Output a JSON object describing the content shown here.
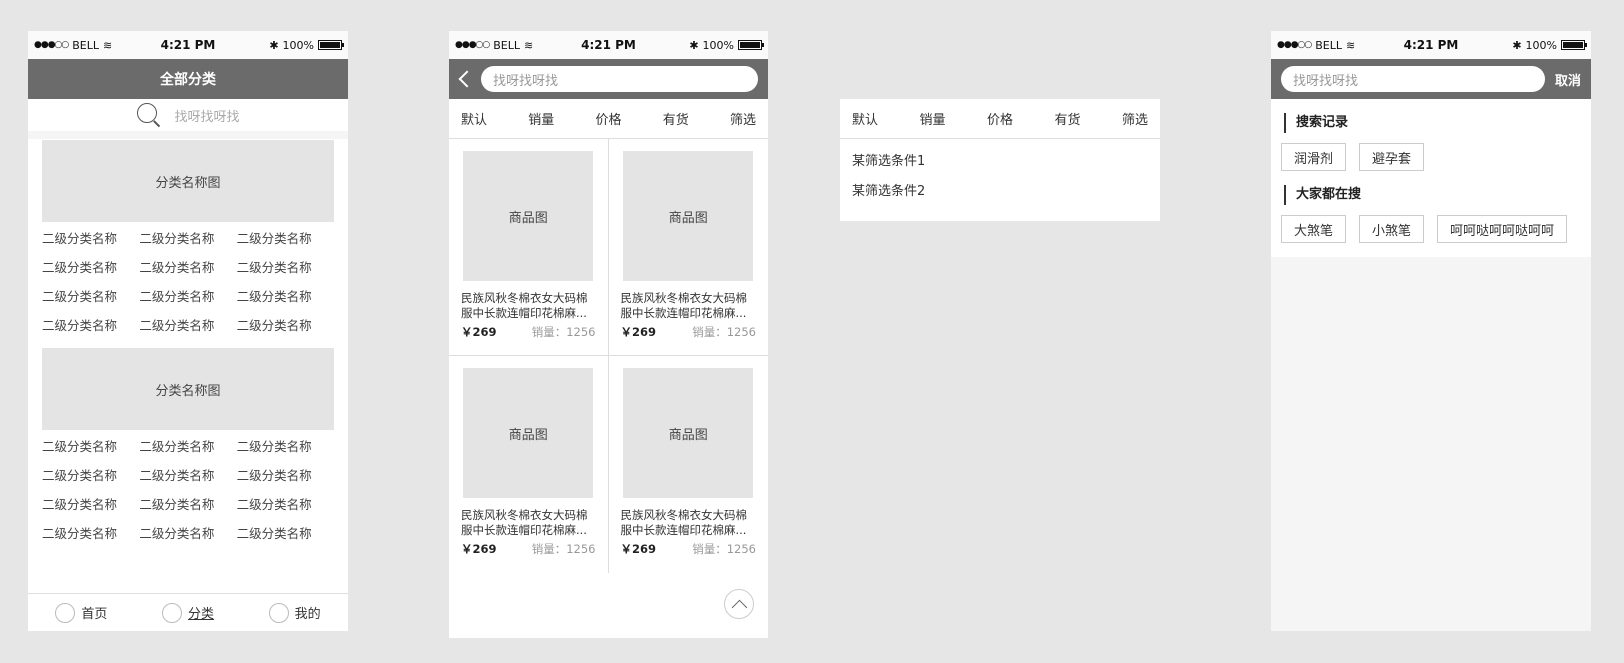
{
  "status": {
    "carrier": "BELL",
    "time": "4:21 PM",
    "battery": "100%"
  },
  "categories_screen": {
    "title": "全部分类",
    "search_placeholder": "找呀找呀找",
    "groups": [
      {
        "image_label": "分类名称图",
        "subcategories": [
          "二级分类名称",
          "二级分类名称",
          "二级分类名称",
          "二级分类名称",
          "二级分类名称",
          "二级分类名称",
          "二级分类名称",
          "二级分类名称",
          "二级分类名称",
          "二级分类名称",
          "二级分类名称",
          "二级分类名称"
        ]
      },
      {
        "image_label": "分类名称图",
        "subcategories": [
          "二级分类名称",
          "二级分类名称",
          "二级分类名称",
          "二级分类名称",
          "二级分类名称",
          "二级分类名称",
          "二级分类名称",
          "二级分类名称",
          "二级分类名称",
          "二级分类名称",
          "二级分类名称",
          "二级分类名称"
        ]
      }
    ],
    "nav": [
      {
        "label": "首页",
        "active": false
      },
      {
        "label": "分类",
        "active": true
      },
      {
        "label": "我的",
        "active": false
      }
    ]
  },
  "list_screen": {
    "search_placeholder": "找呀找呀找",
    "sort_tabs": [
      "默认",
      "销量",
      "价格",
      "有货",
      "筛选"
    ],
    "products": [
      {
        "image_label": "商品图",
        "title": "民族风秋冬棉衣女大码棉服中长款连帽印花棉麻...",
        "price": "￥269",
        "sales": "销量：1256"
      },
      {
        "image_label": "商品图",
        "title": "民族风秋冬棉衣女大码棉服中长款连帽印花棉麻...",
        "price": "￥269",
        "sales": "销量：1256"
      },
      {
        "image_label": "商品图",
        "title": "民族风秋冬棉衣女大码棉服中长款连帽印花棉麻...",
        "price": "￥269",
        "sales": "销量：1256"
      },
      {
        "image_label": "商品图",
        "title": "民族风秋冬棉衣女大码棉服中长款连帽印花棉麻...",
        "price": "￥269",
        "sales": "销量：1256"
      }
    ]
  },
  "filter_panel": {
    "sort_tabs": [
      "默认",
      "销量",
      "价格",
      "有货",
      "筛选"
    ],
    "conditions": [
      "某筛选条件1",
      "某筛选条件2"
    ]
  },
  "search_screen": {
    "search_placeholder": "找呀找呀找",
    "cancel_label": "取消",
    "history_title": "搜索记录",
    "history_tags": [
      "润滑剂",
      "避孕套"
    ],
    "hot_title": "大家都在搜",
    "hot_tags": [
      "大煞笔",
      "小煞笔",
      "呵呵哒呵呵哒呵呵"
    ]
  }
}
